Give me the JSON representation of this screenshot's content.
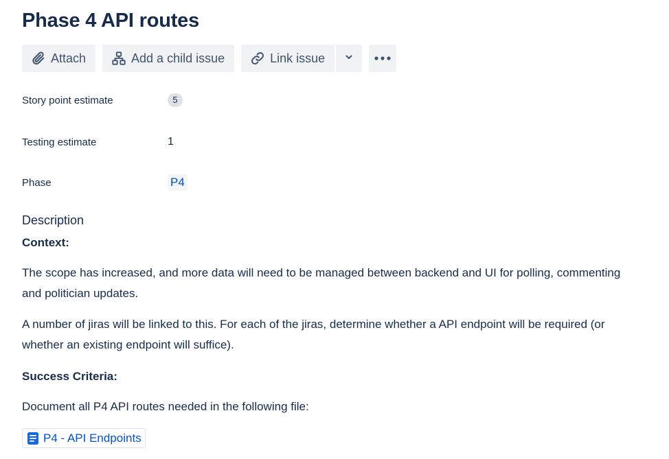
{
  "issue": {
    "title": "Phase 4 API routes"
  },
  "toolbar": {
    "attach_label": "Attach",
    "add_child_label": "Add a child issue",
    "link_issue_label": "Link issue"
  },
  "fields": {
    "story_points": {
      "label": "Story point estimate",
      "value": "5"
    },
    "testing_estimate": {
      "label": "Testing estimate",
      "value": "1"
    },
    "phase": {
      "label": "Phase",
      "value": "P4"
    }
  },
  "description": {
    "heading": "Description",
    "context_heading": "Context:",
    "paragraph_1": "The scope has increased, and more data will need to be managed between backend and UI for polling, commenting and politician updates.",
    "paragraph_2": "A number of jiras will be linked to this. For each of the jiras, determine whether a API endpoint will be required (or whether an existing endpoint will suffice).",
    "success_heading": "Success Criteria:",
    "paragraph_3": "Document all P4 API routes needed in the following file:",
    "link_label": "P4 - API Endpoints"
  },
  "colors": {
    "accent": "#0052cc",
    "text": "#172b4d",
    "button_bg": "#f1f2f4"
  },
  "icons": {
    "attach": "paperclip-icon",
    "child": "hierarchy-icon",
    "link": "link-icon",
    "dropdown": "chevron-down-icon",
    "more": "more-icon",
    "document": "document-icon"
  }
}
